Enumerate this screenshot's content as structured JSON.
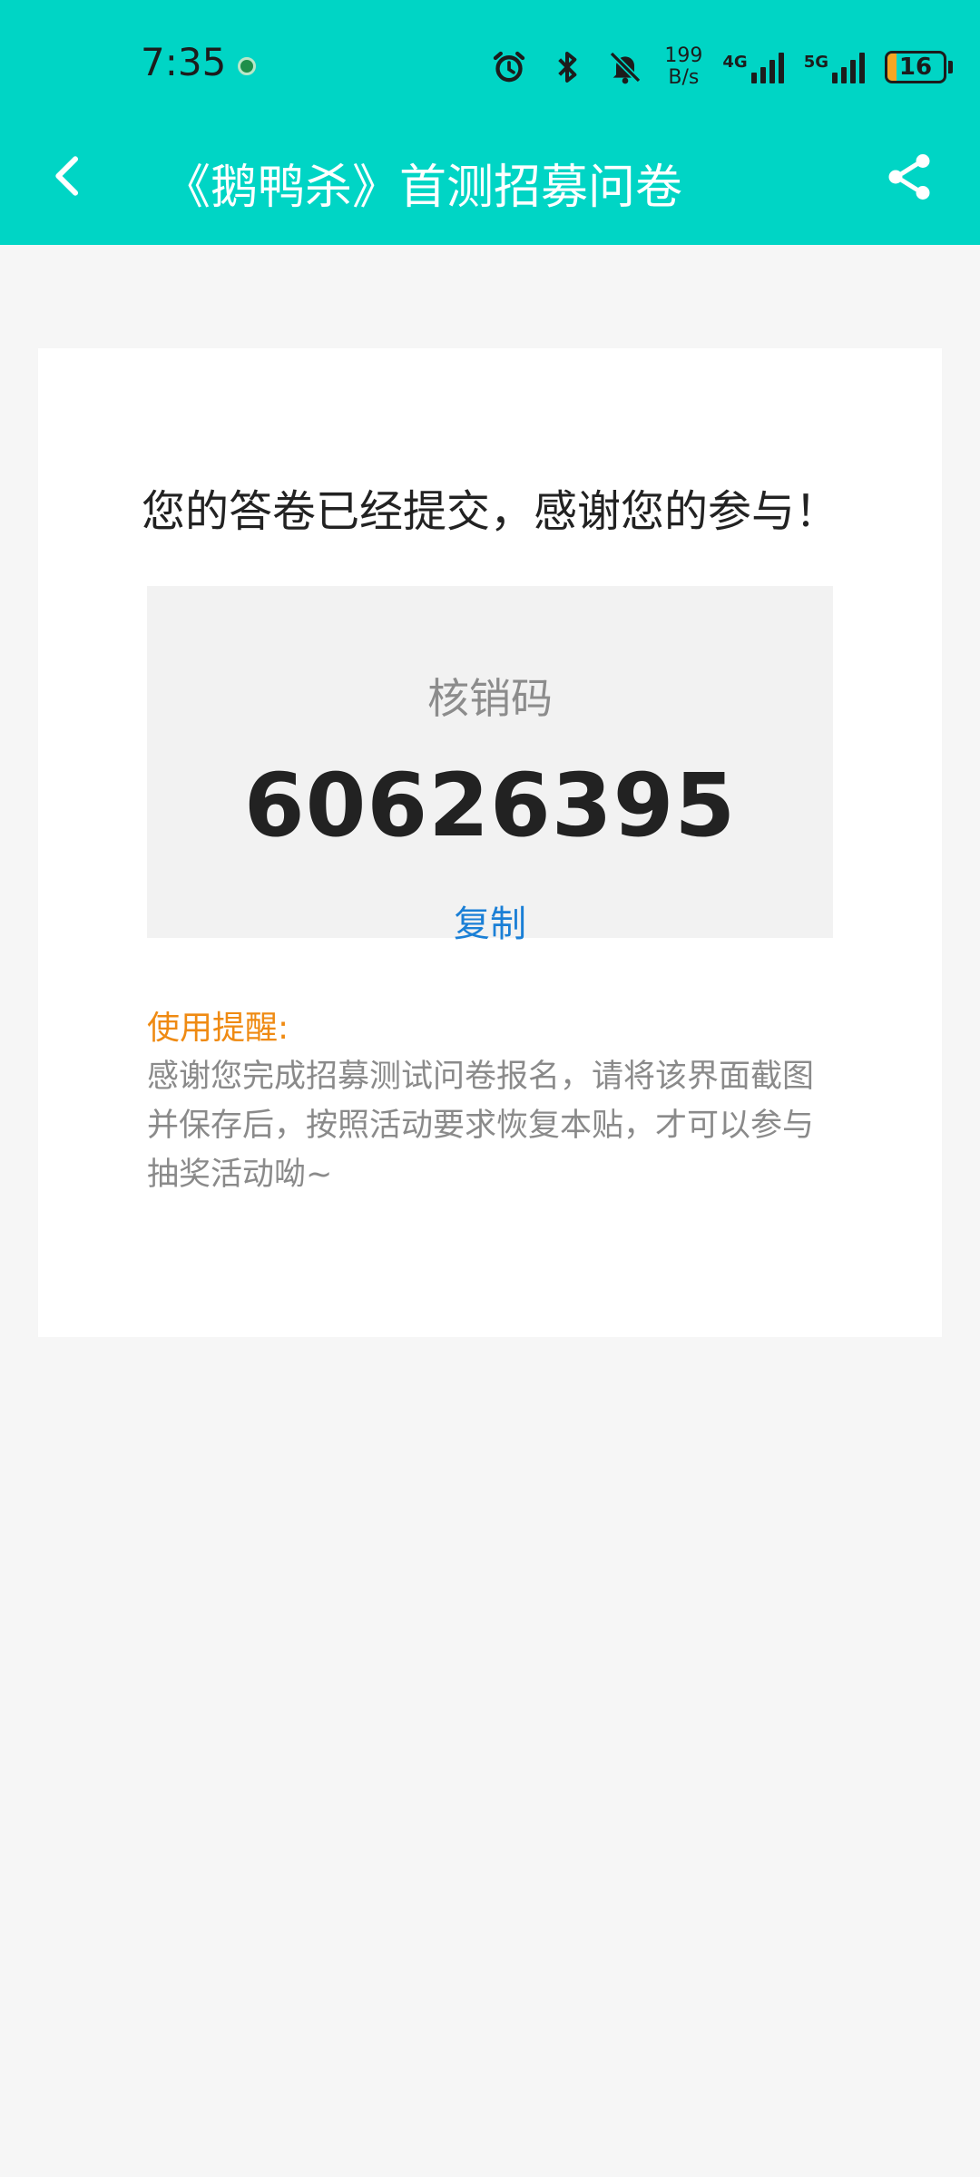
{
  "status_bar": {
    "time": "7:35",
    "net_speed_value": "199",
    "net_speed_unit": "B/s",
    "signal_1_label": "4G",
    "signal_2_label": "5G",
    "battery_level": "16",
    "battery_fill_percent": 16,
    "battery_color": "#f5a623",
    "icons": [
      "alarm-icon",
      "bluetooth-icon",
      "bell-off-icon"
    ]
  },
  "app_bar": {
    "title": "《鹅鸭杀》首测招募问卷",
    "background_color": "#00d5c5",
    "icons": [
      "back-icon",
      "share-icon"
    ]
  },
  "card": {
    "success_message": "您的答卷已经提交，感谢您的参与！",
    "code_label": "核销码",
    "code_value": "60626395",
    "copy_label": "复制",
    "reminder_title": "使用提醒:",
    "reminder_text": "感谢您完成招募测试问卷报名，请将该界面截图并保存后，按照活动要求恢复本贴，才可以参与抽奖活动呦~",
    "accent_color": "#ef8a12",
    "link_color": "#1a7fd6"
  }
}
